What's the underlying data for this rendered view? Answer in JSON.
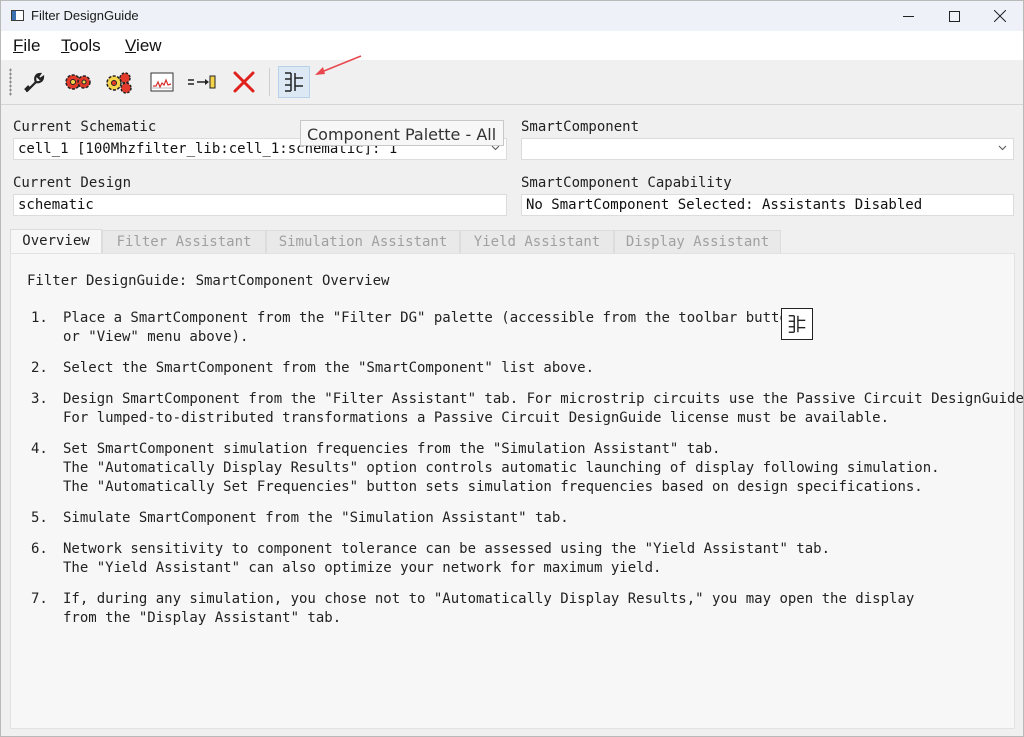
{
  "window": {
    "title": "Filter DesignGuide"
  },
  "menu": {
    "file": "File",
    "tools": "Tools",
    "view": "View"
  },
  "toolbar": {
    "buttons": [
      {
        "icon": "wrench-icon"
      },
      {
        "icon": "gears-red-icon"
      },
      {
        "icon": "gears-multi-icon"
      },
      {
        "icon": "graph-icon"
      },
      {
        "icon": "component-arrow-icon"
      },
      {
        "icon": "delete-x-icon"
      },
      {
        "icon": "component-palette-icon"
      }
    ]
  },
  "tooltip": "Component Palette - All",
  "fields": {
    "current_schematic_label": "Current Schematic",
    "current_schematic_value": "cell_1 [100Mhzfilter_lib:cell_1:schematic]: 1",
    "smartcomponent_label": "SmartComponent",
    "smartcomponent_value": "",
    "current_design_label": "Current Design",
    "current_design_value": "schematic",
    "capability_label": "SmartComponent Capability",
    "capability_value": "No SmartComponent Selected: Assistants Disabled"
  },
  "tabs": [
    "Overview",
    "Filter Assistant",
    "Simulation Assistant",
    "Yield Assistant",
    "Display Assistant"
  ],
  "overview": {
    "title": "Filter DesignGuide: SmartComponent Overview",
    "steps": [
      {
        "num": "1.",
        "lines": [
          "Place a SmartComponent from the \"Filter DG\" palette (accessible from the toolbar button",
          "or \"View\" menu above)."
        ]
      },
      {
        "num": "2.",
        "lines": [
          "Select the SmartComponent from the \"SmartComponent\" list above."
        ]
      },
      {
        "num": "3.",
        "lines": [
          "Design SmartComponent from the \"Filter Assistant\" tab. For microstrip circuits use the Passive Circuit DesignGuide.",
          "For lumped-to-distributed transformations a Passive Circuit DesignGuide license must be available."
        ]
      },
      {
        "num": "4.",
        "lines": [
          "Set SmartComponent simulation frequencies from the \"Simulation Assistant\" tab.",
          "The \"Automatically Display Results\" option controls automatic launching of display following simulation.",
          "The \"Automatically Set Frequencies\" button sets simulation frequencies based on design specifications."
        ]
      },
      {
        "num": "5.",
        "lines": [
          "Simulate SmartComponent from the \"Simulation Assistant\" tab."
        ]
      },
      {
        "num": "6.",
        "lines": [
          "Network sensitivity to component tolerance can be assessed using the \"Yield Assistant\" tab.",
          "The \"Yield Assistant\" can also optimize your network for maximum yield."
        ]
      },
      {
        "num": "7.",
        "lines": [
          "If, during any simulation, you chose not to \"Automatically Display Results,\" you may open the display",
          "from the \"Display Assistant\" tab."
        ]
      }
    ]
  },
  "colors": {
    "accent": "#2a6fb8",
    "annotation_arrow": "#e8484d",
    "delete": "#e0201c"
  }
}
